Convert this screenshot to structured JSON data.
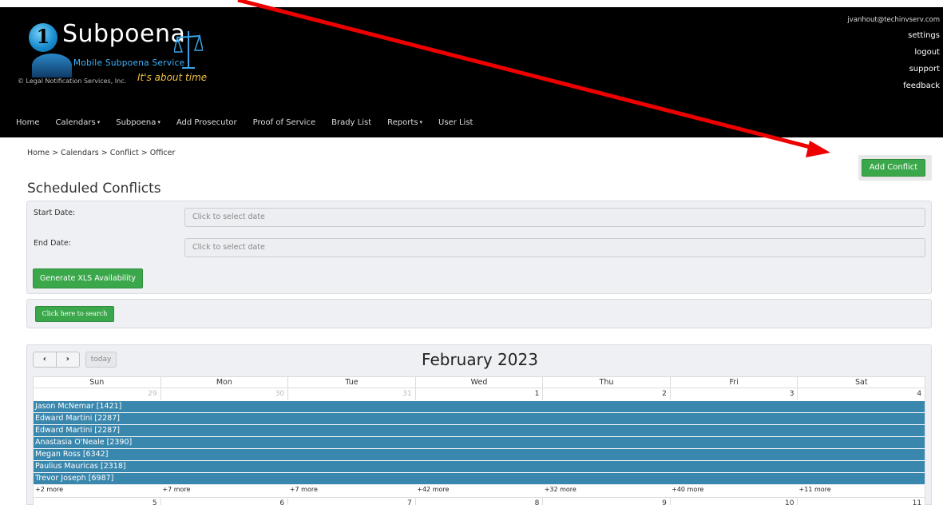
{
  "header": {
    "logo": {
      "badge": "1",
      "name": "Subpoena",
      "subtitle": "Mobile Subpoena Service",
      "copyright": "© Legal Notification Services, Inc.",
      "tagline": "It's about time"
    },
    "user_email": "jvanhout@techinvserv.com",
    "user_links": [
      "settings",
      "logout",
      "support",
      "feedback"
    ]
  },
  "nav": [
    {
      "label": "Home",
      "dropdown": false
    },
    {
      "label": "Calendars",
      "dropdown": true
    },
    {
      "label": "Subpoena",
      "dropdown": true
    },
    {
      "label": "Add Prosecutor",
      "dropdown": false
    },
    {
      "label": "Proof of Service",
      "dropdown": false
    },
    {
      "label": "Brady List",
      "dropdown": false
    },
    {
      "label": "Reports",
      "dropdown": true
    },
    {
      "label": "User List",
      "dropdown": false
    }
  ],
  "breadcrumb": "Home > Calendars > Conflict > Officer",
  "add_conflict_label": "Add Conflict",
  "page_title": "Scheduled Conflicts",
  "filters": {
    "start_label": "Start Date:",
    "start_placeholder": "Click to select date",
    "end_label": "End Date:",
    "end_placeholder": "Click to select date",
    "generate_label": "Generate XLS Availability"
  },
  "search_label": "Click here to search",
  "calendar": {
    "prev_icon": "‹",
    "next_icon": "›",
    "today_label": "today",
    "title": "February 2023",
    "days_of_week": [
      "Sun",
      "Mon",
      "Tue",
      "Wed",
      "Thu",
      "Fri",
      "Sat"
    ],
    "week1_days": [
      "29",
      "30",
      "31",
      "1",
      "2",
      "3",
      "4"
    ],
    "week1_other_month": [
      true,
      true,
      true,
      false,
      false,
      false,
      false
    ],
    "events": [
      "Jason McNemar [1421]",
      "Edward Martini [2287]",
      "Edward Martini [2287]",
      "Anastasia O'Neale [2390]",
      "Megan Ross [6342]",
      "Paulius Mauricas [2318]",
      "Trevor Joseph [6987]"
    ],
    "more_links": [
      "+2 more",
      "+7 more",
      "+7 more",
      "+42 more",
      "+32 more",
      "+40 more",
      "+11 more"
    ],
    "week2_days": [
      "5",
      "6",
      "7",
      "8",
      "9",
      "10",
      "11"
    ]
  },
  "colors": {
    "header_bg": "#000000",
    "button_green": "#3aa84a",
    "event_blue": "#3a87ad",
    "annotation_arrow": "#ee0000"
  }
}
